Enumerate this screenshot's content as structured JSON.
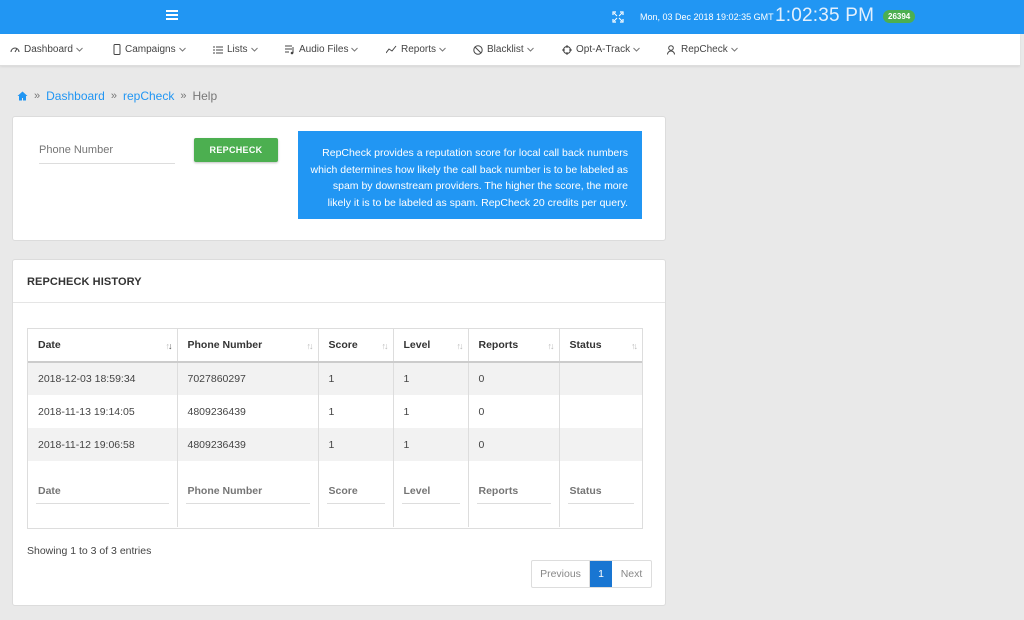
{
  "topbar": {
    "datetime": "Mon, 03 Dec 2018 19:02:35 GMT",
    "clock": "1:02:35 PM",
    "credits": "26394",
    "accent_color": "#2196f3"
  },
  "nav": {
    "items": [
      {
        "label": "Dashboard",
        "icon": "dashboard-icon"
      },
      {
        "label": "Campaigns",
        "icon": "mobile-icon"
      },
      {
        "label": "Lists",
        "icon": "list-icon"
      },
      {
        "label": "Audio Files",
        "icon": "audio-icon"
      },
      {
        "label": "Reports",
        "icon": "chart-line-icon"
      },
      {
        "label": "Blacklist",
        "icon": "ban-icon"
      },
      {
        "label": "Opt-A-Track",
        "icon": "crosshair-icon"
      },
      {
        "label": "RepCheck",
        "icon": "user-check-icon"
      }
    ]
  },
  "breadcrumb": {
    "items": [
      "Dashboard",
      "repCheck",
      "Help"
    ],
    "separator": "»"
  },
  "repcheck_form": {
    "phone_placeholder": "Phone Number",
    "button_label": "REPCHECK",
    "info": "RepCheck provides a reputation score for local call back numbers which determines how likely the call back number is to be labeled as spam by downstream providers. The higher the score, the more likely it is to be labeled as spam. RepCheck 20 credits per query."
  },
  "history": {
    "title": "REPCHECK HISTORY",
    "columns": [
      "Date",
      "Phone Number",
      "Score",
      "Level",
      "Reports",
      "Status"
    ],
    "rows": [
      {
        "date": "2018-12-03 18:59:34",
        "phone": "7027860297",
        "score": "1",
        "level": "1",
        "reports": "0",
        "status": ""
      },
      {
        "date": "2018-11-13 19:14:05",
        "phone": "4809236439",
        "score": "1",
        "level": "1",
        "reports": "0",
        "status": ""
      },
      {
        "date": "2018-11-12 19:06:58",
        "phone": "4809236439",
        "score": "1",
        "level": "1",
        "reports": "0",
        "status": ""
      }
    ],
    "filters": [
      "Date",
      "Phone Number",
      "Score",
      "Level",
      "Reports",
      "Status"
    ],
    "info": "Showing 1 to 3 of 3 entries",
    "pagination": {
      "previous": "Previous",
      "current": "1",
      "next": "Next"
    }
  }
}
